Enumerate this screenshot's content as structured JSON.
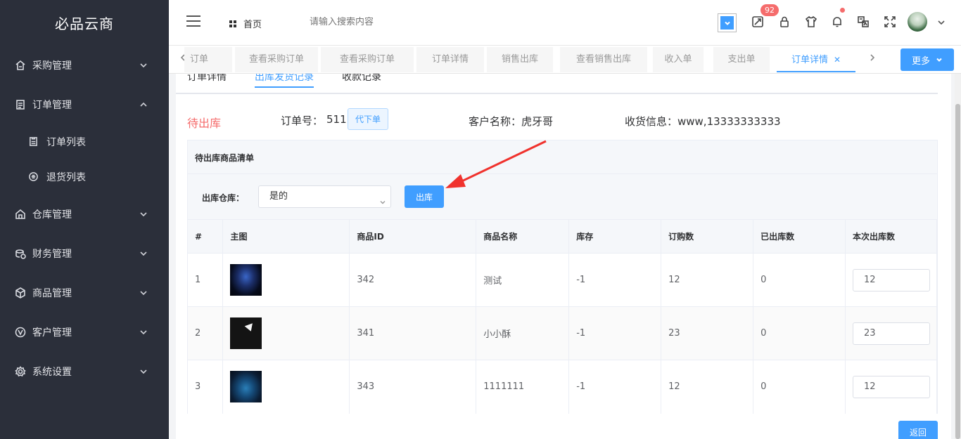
{
  "sidebar": {
    "brand": "必品云商",
    "menu": [
      {
        "label": "采购管理",
        "icon": "purchase-icon"
      },
      {
        "label": "订单管理",
        "icon": "order-icon"
      },
      {
        "label": "仓库管理",
        "icon": "warehouse-icon"
      },
      {
        "label": "财务管理",
        "icon": "finance-icon"
      },
      {
        "label": "商品管理",
        "icon": "product-icon"
      },
      {
        "label": "客户管理",
        "icon": "customer-icon"
      },
      {
        "label": "系统设置",
        "icon": "settings-icon"
      }
    ],
    "sub": [
      {
        "label": "订单列表",
        "icon": "list-icon"
      },
      {
        "label": "退货列表",
        "icon": "return-icon"
      }
    ]
  },
  "header": {
    "home": "首页",
    "search_placeholder": "请输入搜索内容",
    "badge_count": "92"
  },
  "tabs": [
    "订单",
    "查看采购订单",
    "查看采购订单",
    "订单详情",
    "销售出库",
    "查看销售出库",
    "收入单",
    "支出单",
    "订单详情"
  ],
  "tabs_more": "更多",
  "subtabs": [
    "订单详情",
    "出库发货记录",
    "收款记录"
  ],
  "order": {
    "status": "待出库",
    "order_no_label": "订单号：",
    "order_no": "511",
    "proxy_button": "代下单",
    "customer": "客户名称：虎牙哥",
    "receiving": "收货信息：www,13333333333"
  },
  "panel": {
    "title": "待出库商品清单",
    "warehouse_label": "出库仓库：",
    "warehouse_value": "是的",
    "out_button": "出库"
  },
  "table": {
    "headers": [
      "#",
      "主图",
      "商品ID",
      "商品名称",
      "库存",
      "订购数",
      "已出库数",
      "本次出库数"
    ],
    "rows": [
      {
        "idx": "1",
        "id": "342",
        "name": "测试",
        "stock": "-1",
        "ordered": "12",
        "shipped": "0",
        "qty": "12"
      },
      {
        "idx": "2",
        "id": "341",
        "name": "小小酥",
        "stock": "-1",
        "ordered": "23",
        "shipped": "0",
        "qty": "23"
      },
      {
        "idx": "3",
        "id": "343",
        "name": "1111111",
        "stock": "-1",
        "ordered": "12",
        "shipped": "0",
        "qty": "12"
      }
    ]
  },
  "back_button": "返回",
  "colors": {
    "primary": "#409eff",
    "danger": "#f56c6c",
    "sidebar": "#2b2f3a"
  }
}
